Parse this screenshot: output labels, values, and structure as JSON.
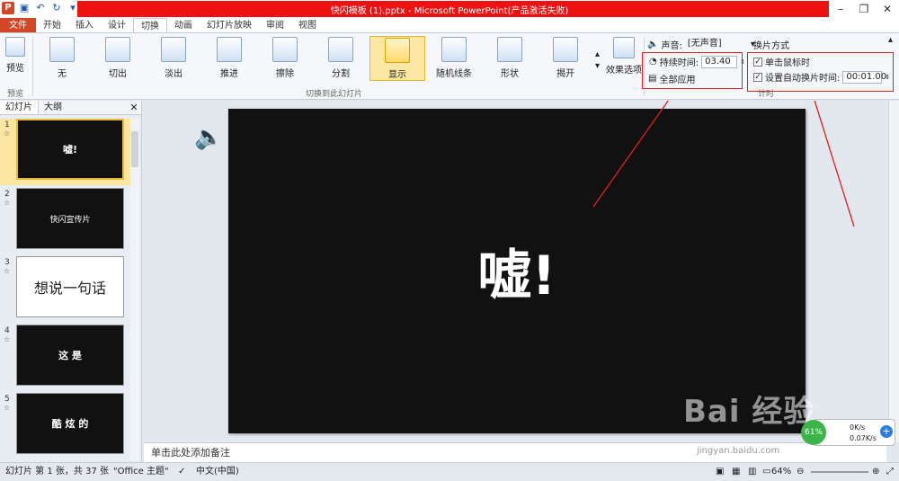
{
  "window": {
    "title": "快闪模板 (1).pptx - Microsoft PowerPoint(产品激活失败)",
    "controls": [
      "–",
      "❐",
      "✕"
    ]
  },
  "ribbon_tabs": [
    "文件",
    "开始",
    "插入",
    "设计",
    "切换",
    "动画",
    "幻灯片放映",
    "审阅",
    "视图"
  ],
  "preview": {
    "label": "预览",
    "group": "预览"
  },
  "transitions": [
    "无",
    "切出",
    "淡出",
    "推进",
    "擦除",
    "分割",
    "显示",
    "随机线条",
    "形状",
    "揭开"
  ],
  "transition_group": "切换到此幻灯片",
  "effect_options": "效果选项",
  "timing": {
    "sound_label": "声音:",
    "sound_value": "[无声音]",
    "duration_label": "持续时间:",
    "duration_value": "03.40",
    "apply_all": "全部应用",
    "advance_title": "换片方式",
    "on_click": "单击鼠标时",
    "auto_after": "设置自动换片时间:",
    "auto_value": "00:01.00",
    "group": "计时"
  },
  "left_pane": {
    "tabs": [
      "幻灯片",
      "大纲"
    ],
    "slides": [
      {
        "num": "1",
        "text": "嘘!"
      },
      {
        "num": "2",
        "text": "快闪宣传片"
      },
      {
        "num": "3",
        "text": "想说一句话"
      },
      {
        "num": "4",
        "text": "这 是"
      },
      {
        "num": "5",
        "text": "酷 炫 的"
      }
    ]
  },
  "slide": {
    "text": "嘘!"
  },
  "notes_placeholder": "单击此处添加备注",
  "status": {
    "slide_info": "幻灯片 第 1 张，共 37 张",
    "theme": "\"Office 主题\"",
    "language": "中文(中国)",
    "zoom": "64%"
  },
  "speed": {
    "up": "0K/s",
    "down": "0.07K/s",
    "pct": "61%"
  },
  "watermark": {
    "text": "Bai 经验",
    "url": "jingyan.baidu.com"
  }
}
